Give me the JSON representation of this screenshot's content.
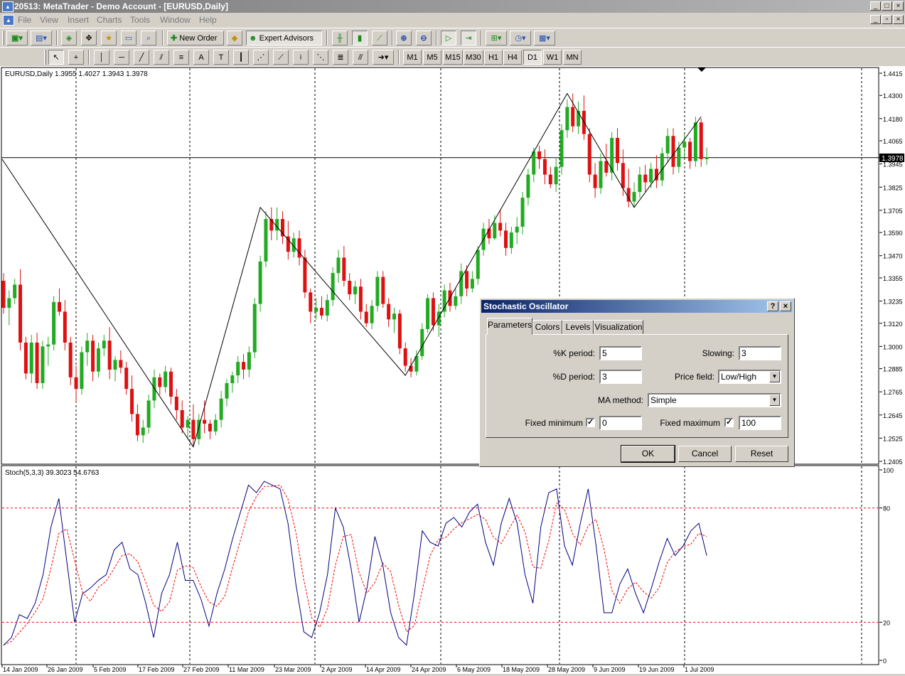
{
  "window": {
    "title": "20513: MetaTrader - Demo Account - [EURUSD,Daily]",
    "app_icon": "mt-icon"
  },
  "menu": [
    "File",
    "View",
    "Insert",
    "Charts",
    "Tools",
    "Window",
    "Help"
  ],
  "toolbar": {
    "new_order": "New Order",
    "expert_advisors": "Expert Advisors"
  },
  "timeframes": [
    "M1",
    "M5",
    "M15",
    "M30",
    "H1",
    "H4",
    "D1",
    "W1",
    "MN"
  ],
  "active_timeframe": "D1",
  "chart": {
    "header": "EURUSD,Daily  1.3955 1.4027 1.3943 1.3978",
    "price_labels": [
      "1.4415",
      "1.4300",
      "1.4180",
      "1.4065",
      "1.3945",
      "1.3825",
      "1.3705",
      "1.3590",
      "1.3470",
      "1.3355",
      "1.3235",
      "1.3120",
      "1.3000",
      "1.2885",
      "1.2765",
      "1.2645",
      "1.2525",
      "1.2405"
    ],
    "current_price": "1.3978",
    "date_labels": [
      "14 Jan 2009",
      "26 Jan 2009",
      "5 Feb 2009",
      "17 Feb 2009",
      "27 Feb 2009",
      "11 Mar 2009",
      "23 Mar 2009",
      "2 Apr 2009",
      "14 Apr 2009",
      "24 Apr 2009",
      "6 May 2009",
      "18 May 2009",
      "28 May 2009",
      "9 Jun 2009",
      "19 Jun 2009",
      "1 Jul 2009"
    ],
    "indicator_header": "Stoch(5,3,3) 39.3023 54.6763",
    "indicator_labels": [
      "100",
      "80",
      "20",
      "0"
    ],
    "colors": {
      "bull": "#22aa22",
      "bear": "#dd1111",
      "main_line": "#000080",
      "signal_line": "#ff0000"
    }
  },
  "dialog": {
    "title": "Stochastic Oscillator",
    "help_btn": "?",
    "close_btn": "×",
    "tabs": [
      "Parameters",
      "Colors",
      "Levels",
      "Visualization"
    ],
    "active_tab": "Parameters",
    "k_period_label": "%K period:",
    "k_period": "5",
    "d_period_label": "%D period:",
    "d_period": "3",
    "slowing_label": "Slowing:",
    "slowing": "3",
    "price_field_label": "Price field:",
    "price_field": "Low/High",
    "ma_method_label": "MA method:",
    "ma_method": "Simple",
    "fixed_min_label": "Fixed minimum",
    "fixed_min": "0",
    "fixed_min_checked": "✓",
    "fixed_max_label": "Fixed maximum",
    "fixed_max": "100",
    "fixed_max_checked": "✓",
    "ok": "OK",
    "cancel": "Cancel",
    "reset": "Reset"
  },
  "chart_data": {
    "type": "candlestick",
    "symbol": "EURUSD",
    "period": "Daily",
    "ylim": [
      1.2405,
      1.4415
    ],
    "candles": [
      [
        1.334,
        1.338,
        1.317,
        1.32
      ],
      [
        1.32,
        1.329,
        1.311,
        1.325
      ],
      [
        1.325,
        1.335,
        1.322,
        1.332
      ],
      [
        1.332,
        1.34,
        1.298,
        1.302
      ],
      [
        1.302,
        1.305,
        1.283,
        1.286
      ],
      [
        1.286,
        1.306,
        1.281,
        1.302
      ],
      [
        1.302,
        1.307,
        1.278,
        1.281
      ],
      [
        1.281,
        1.303,
        1.278,
        1.3
      ],
      [
        1.3,
        1.305,
        1.29,
        1.301
      ],
      [
        1.301,
        1.326,
        1.298,
        1.323
      ],
      [
        1.323,
        1.33,
        1.316,
        1.318
      ],
      [
        1.318,
        1.324,
        1.298,
        1.302
      ],
      [
        1.302,
        1.305,
        1.28,
        1.284
      ],
      [
        1.284,
        1.29,
        1.271,
        1.278
      ],
      [
        1.278,
        1.3,
        1.275,
        1.297
      ],
      [
        1.297,
        1.307,
        1.29,
        1.303
      ],
      [
        1.303,
        1.306,
        1.282,
        1.287
      ],
      [
        1.287,
        1.302,
        1.284,
        1.299
      ],
      [
        1.299,
        1.306,
        1.295,
        1.303
      ],
      [
        1.303,
        1.31,
        1.283,
        1.288
      ],
      [
        1.288,
        1.295,
        1.282,
        1.293
      ],
      [
        1.293,
        1.298,
        1.286,
        1.289
      ],
      [
        1.289,
        1.292,
        1.275,
        1.278
      ],
      [
        1.278,
        1.285,
        1.261,
        1.265
      ],
      [
        1.265,
        1.27,
        1.251,
        1.254
      ],
      [
        1.254,
        1.262,
        1.25,
        1.258
      ],
      [
        1.258,
        1.275,
        1.255,
        1.272
      ],
      [
        1.272,
        1.288,
        1.268,
        1.284
      ],
      [
        1.284,
        1.286,
        1.275,
        1.279
      ],
      [
        1.279,
        1.29,
        1.276,
        1.287
      ],
      [
        1.287,
        1.289,
        1.27,
        1.274
      ],
      [
        1.274,
        1.278,
        1.262,
        1.267
      ],
      [
        1.267,
        1.272,
        1.255,
        1.258
      ],
      [
        1.258,
        1.264,
        1.252,
        1.262
      ],
      [
        1.262,
        1.27,
        1.248,
        1.252
      ],
      [
        1.252,
        1.265,
        1.249,
        1.262
      ],
      [
        1.262,
        1.272,
        1.255,
        1.26
      ],
      [
        1.26,
        1.262,
        1.252,
        1.256
      ],
      [
        1.256,
        1.265,
        1.254,
        1.262
      ],
      [
        1.262,
        1.277,
        1.258,
        1.273
      ],
      [
        1.273,
        1.283,
        1.269,
        1.281
      ],
      [
        1.281,
        1.287,
        1.276,
        1.285
      ],
      [
        1.285,
        1.295,
        1.281,
        1.292
      ],
      [
        1.292,
        1.296,
        1.283,
        1.288
      ],
      [
        1.288,
        1.3,
        1.284,
        1.297
      ],
      [
        1.297,
        1.325,
        1.294,
        1.322
      ],
      [
        1.322,
        1.347,
        1.318,
        1.344
      ],
      [
        1.344,
        1.37,
        1.341,
        1.366
      ],
      [
        1.366,
        1.372,
        1.355,
        1.36
      ],
      [
        1.36,
        1.372,
        1.355,
        1.366
      ],
      [
        1.366,
        1.37,
        1.353,
        1.357
      ],
      [
        1.357,
        1.365,
        1.345,
        1.349
      ],
      [
        1.349,
        1.359,
        1.346,
        1.356
      ],
      [
        1.356,
        1.36,
        1.342,
        1.346
      ],
      [
        1.346,
        1.35,
        1.325,
        1.328
      ],
      [
        1.328,
        1.33,
        1.312,
        1.318
      ],
      [
        1.318,
        1.325,
        1.314,
        1.32
      ],
      [
        1.32,
        1.326,
        1.314,
        1.316
      ],
      [
        1.316,
        1.327,
        1.313,
        1.324
      ],
      [
        1.324,
        1.341,
        1.321,
        1.338
      ],
      [
        1.338,
        1.35,
        1.333,
        1.346
      ],
      [
        1.346,
        1.352,
        1.331,
        1.334
      ],
      [
        1.334,
        1.338,
        1.324,
        1.327
      ],
      [
        1.327,
        1.334,
        1.322,
        1.331
      ],
      [
        1.331,
        1.335,
        1.314,
        1.318
      ],
      [
        1.318,
        1.322,
        1.31,
        1.312
      ],
      [
        1.312,
        1.324,
        1.309,
        1.321
      ],
      [
        1.321,
        1.339,
        1.318,
        1.336
      ],
      [
        1.336,
        1.339,
        1.32,
        1.322
      ],
      [
        1.322,
        1.325,
        1.31,
        1.314
      ],
      [
        1.314,
        1.32,
        1.307,
        1.317
      ],
      [
        1.317,
        1.319,
        1.296,
        1.299
      ],
      [
        1.299,
        1.302,
        1.287,
        1.29
      ],
      [
        1.29,
        1.294,
        1.284,
        1.287
      ],
      [
        1.287,
        1.298,
        1.285,
        1.295
      ],
      [
        1.295,
        1.312,
        1.293,
        1.309
      ],
      [
        1.309,
        1.327,
        1.307,
        1.325
      ],
      [
        1.325,
        1.328,
        1.308,
        1.311
      ],
      [
        1.311,
        1.322,
        1.305,
        1.318
      ],
      [
        1.318,
        1.332,
        1.315,
        1.329
      ],
      [
        1.329,
        1.333,
        1.318,
        1.321
      ],
      [
        1.321,
        1.33,
        1.319,
        1.326
      ],
      [
        1.326,
        1.343,
        1.322,
        1.339
      ],
      [
        1.339,
        1.342,
        1.326,
        1.33
      ],
      [
        1.33,
        1.339,
        1.328,
        1.335
      ],
      [
        1.335,
        1.352,
        1.332,
        1.35
      ],
      [
        1.35,
        1.364,
        1.347,
        1.361
      ],
      [
        1.361,
        1.366,
        1.353,
        1.356
      ],
      [
        1.356,
        1.368,
        1.355,
        1.364
      ],
      [
        1.364,
        1.371,
        1.357,
        1.36
      ],
      [
        1.36,
        1.364,
        1.347,
        1.351
      ],
      [
        1.351,
        1.362,
        1.348,
        1.359
      ],
      [
        1.359,
        1.367,
        1.353,
        1.362
      ],
      [
        1.362,
        1.38,
        1.358,
        1.377
      ],
      [
        1.377,
        1.392,
        1.373,
        1.389
      ],
      [
        1.389,
        1.403,
        1.385,
        1.401
      ],
      [
        1.401,
        1.404,
        1.392,
        1.397
      ],
      [
        1.397,
        1.402,
        1.384,
        1.389
      ],
      [
        1.389,
        1.393,
        1.382,
        1.384
      ],
      [
        1.384,
        1.398,
        1.38,
        1.393
      ],
      [
        1.393,
        1.415,
        1.389,
        1.412
      ],
      [
        1.412,
        1.428,
        1.408,
        1.424
      ],
      [
        1.424,
        1.431,
        1.411,
        1.414
      ],
      [
        1.414,
        1.427,
        1.41,
        1.422
      ],
      [
        1.422,
        1.43,
        1.407,
        1.41
      ],
      [
        1.41,
        1.413,
        1.385,
        1.389
      ],
      [
        1.389,
        1.395,
        1.377,
        1.382
      ],
      [
        1.382,
        1.4,
        1.379,
        1.396
      ],
      [
        1.396,
        1.405,
        1.388,
        1.39
      ],
      [
        1.39,
        1.411,
        1.386,
        1.408
      ],
      [
        1.408,
        1.413,
        1.391,
        1.395
      ],
      [
        1.395,
        1.402,
        1.378,
        1.382
      ],
      [
        1.382,
        1.392,
        1.372,
        1.375
      ],
      [
        1.375,
        1.385,
        1.372,
        1.38
      ],
      [
        1.38,
        1.393,
        1.377,
        1.389
      ],
      [
        1.389,
        1.394,
        1.38,
        1.385
      ],
      [
        1.385,
        1.395,
        1.382,
        1.392
      ],
      [
        1.392,
        1.399,
        1.382,
        1.386
      ],
      [
        1.386,
        1.403,
        1.383,
        1.4
      ],
      [
        1.4,
        1.413,
        1.395,
        1.409
      ],
      [
        1.409,
        1.413,
        1.389,
        1.393
      ],
      [
        1.393,
        1.406,
        1.39,
        1.403
      ],
      [
        1.403,
        1.41,
        1.398,
        1.406
      ],
      [
        1.406,
        1.408,
        1.392,
        1.396
      ],
      [
        1.396,
        1.419,
        1.393,
        1.416
      ],
      [
        1.416,
        1.418,
        1.393,
        1.397
      ],
      [
        1.397,
        1.403,
        1.394,
        1.398
      ]
    ],
    "zigzag": [
      [
        0,
        1.397
      ],
      [
        34,
        1.248
      ],
      [
        46,
        1.372
      ],
      [
        72,
        1.285
      ],
      [
        101,
        1.431
      ],
      [
        113,
        1.372
      ],
      [
        125,
        1.419
      ]
    ],
    "stoch_main": [
      8,
      12,
      24,
      22,
      30,
      45,
      70,
      85,
      52,
      20,
      35,
      38,
      42,
      45,
      58,
      62,
      48,
      45,
      30,
      12,
      35,
      45,
      62,
      42,
      42,
      32,
      18,
      35,
      48,
      64,
      78,
      92,
      88,
      94,
      92,
      90,
      72,
      40,
      15,
      12,
      25,
      45,
      80,
      70,
      48,
      20,
      38,
      65,
      50,
      25,
      12,
      8,
      35,
      68,
      62,
      60,
      72,
      75,
      70,
      78,
      82,
      62,
      50,
      72,
      85,
      72,
      45,
      30,
      70,
      88,
      90,
      60,
      50,
      72,
      90,
      60,
      25,
      25,
      40,
      48,
      35,
      25,
      38,
      52,
      64,
      55,
      60,
      68,
      72,
      55
    ]
  }
}
